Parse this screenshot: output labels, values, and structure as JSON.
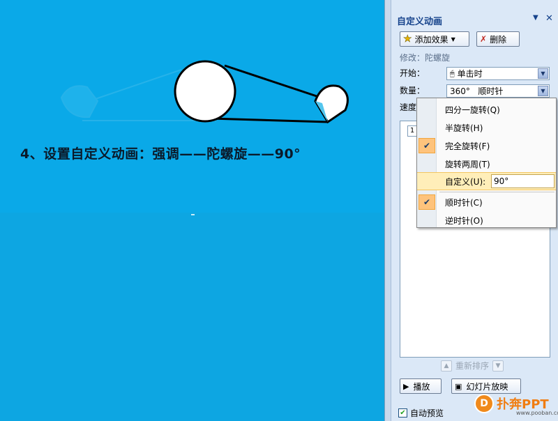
{
  "slide": {
    "caption": "4、设置自定义动画：强调——陀螺旋——90°"
  },
  "panel": {
    "title": "自定义动画",
    "dropdown_arrow": "▼",
    "close": "✕",
    "add_effect_label": "添加效果",
    "delete_label": "删除",
    "modify_label": "修改：陀螺旋",
    "start_label": "开始：",
    "start_value": "单击时",
    "amount_label": "数量：",
    "amount_value": "360°   顺时针",
    "speed_label": "速度",
    "list_item_number": "1",
    "reorder_label": "重新排序",
    "play_label": "播放",
    "slideshow_label": "幻灯片放映",
    "autopreview_label": "自动预览",
    "autopreview_checked": true
  },
  "menu": {
    "items": [
      {
        "label": "四分一旋转(Q)",
        "checked": false
      },
      {
        "label": "半旋转(H)",
        "checked": false
      },
      {
        "label": "完全旋转(F)",
        "checked": true
      },
      {
        "label": "旋转两周(T)",
        "checked": false
      },
      {
        "label": "自定义(U):",
        "checked": false
      },
      {
        "label": "顺时针(C)",
        "checked": true
      },
      {
        "label": "逆时针(O)",
        "checked": false
      }
    ],
    "custom_value": "90°"
  },
  "brand": {
    "name": "扑奔PPT",
    "url": "www.pooban.com"
  },
  "colors": {
    "slide_bg": "#0aa9e8",
    "panel_bg": "#dbe8f7",
    "menu_highlight": "#ffeeb9",
    "check_bg": "#fec37c",
    "brand_orange": "#f07d12"
  }
}
